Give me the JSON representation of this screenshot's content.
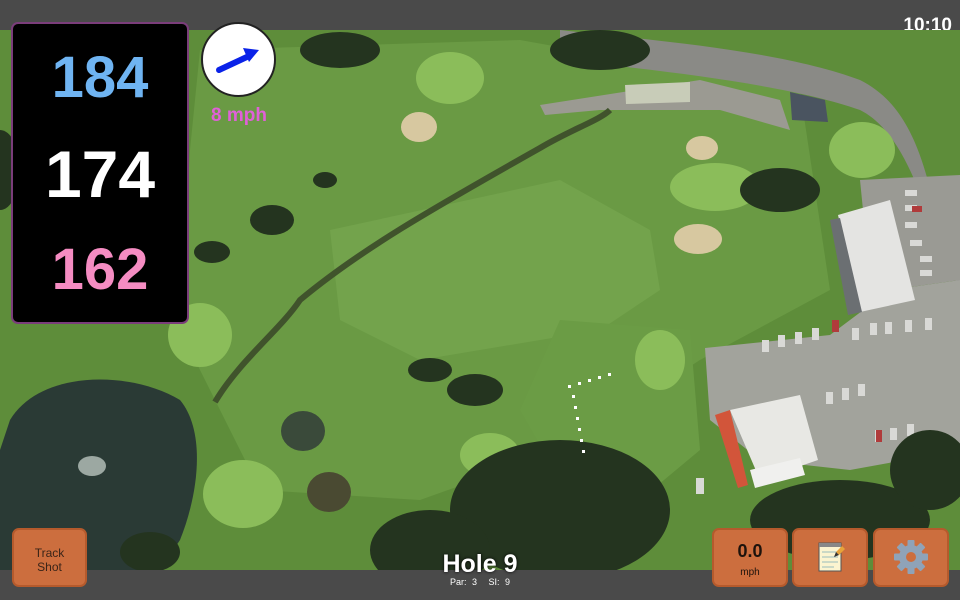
{
  "status_bar": {
    "time": "10:10"
  },
  "distances": {
    "back": "184",
    "middle": "174",
    "front": "162",
    "colors": {
      "back": "#6fb4f2",
      "middle": "#ffffff",
      "front": "#f58cc2"
    }
  },
  "wind": {
    "speed_label": "8 mph",
    "label_color": "#e060d8",
    "arrow_color": "#0a22e8",
    "direction_icon": "wind-arrow-icon"
  },
  "buttons": {
    "track_shot": {
      "line1": "Track",
      "line2": "Shot"
    },
    "speed": {
      "value": "0.0",
      "unit": "mph"
    },
    "notes": {
      "icon": "notepad-icon"
    },
    "settings": {
      "icon": "gear-icon"
    },
    "accent": "#cc6e3e"
  },
  "hole": {
    "title": "Hole 9",
    "par": "Par: 3",
    "si": "SI: 9"
  }
}
